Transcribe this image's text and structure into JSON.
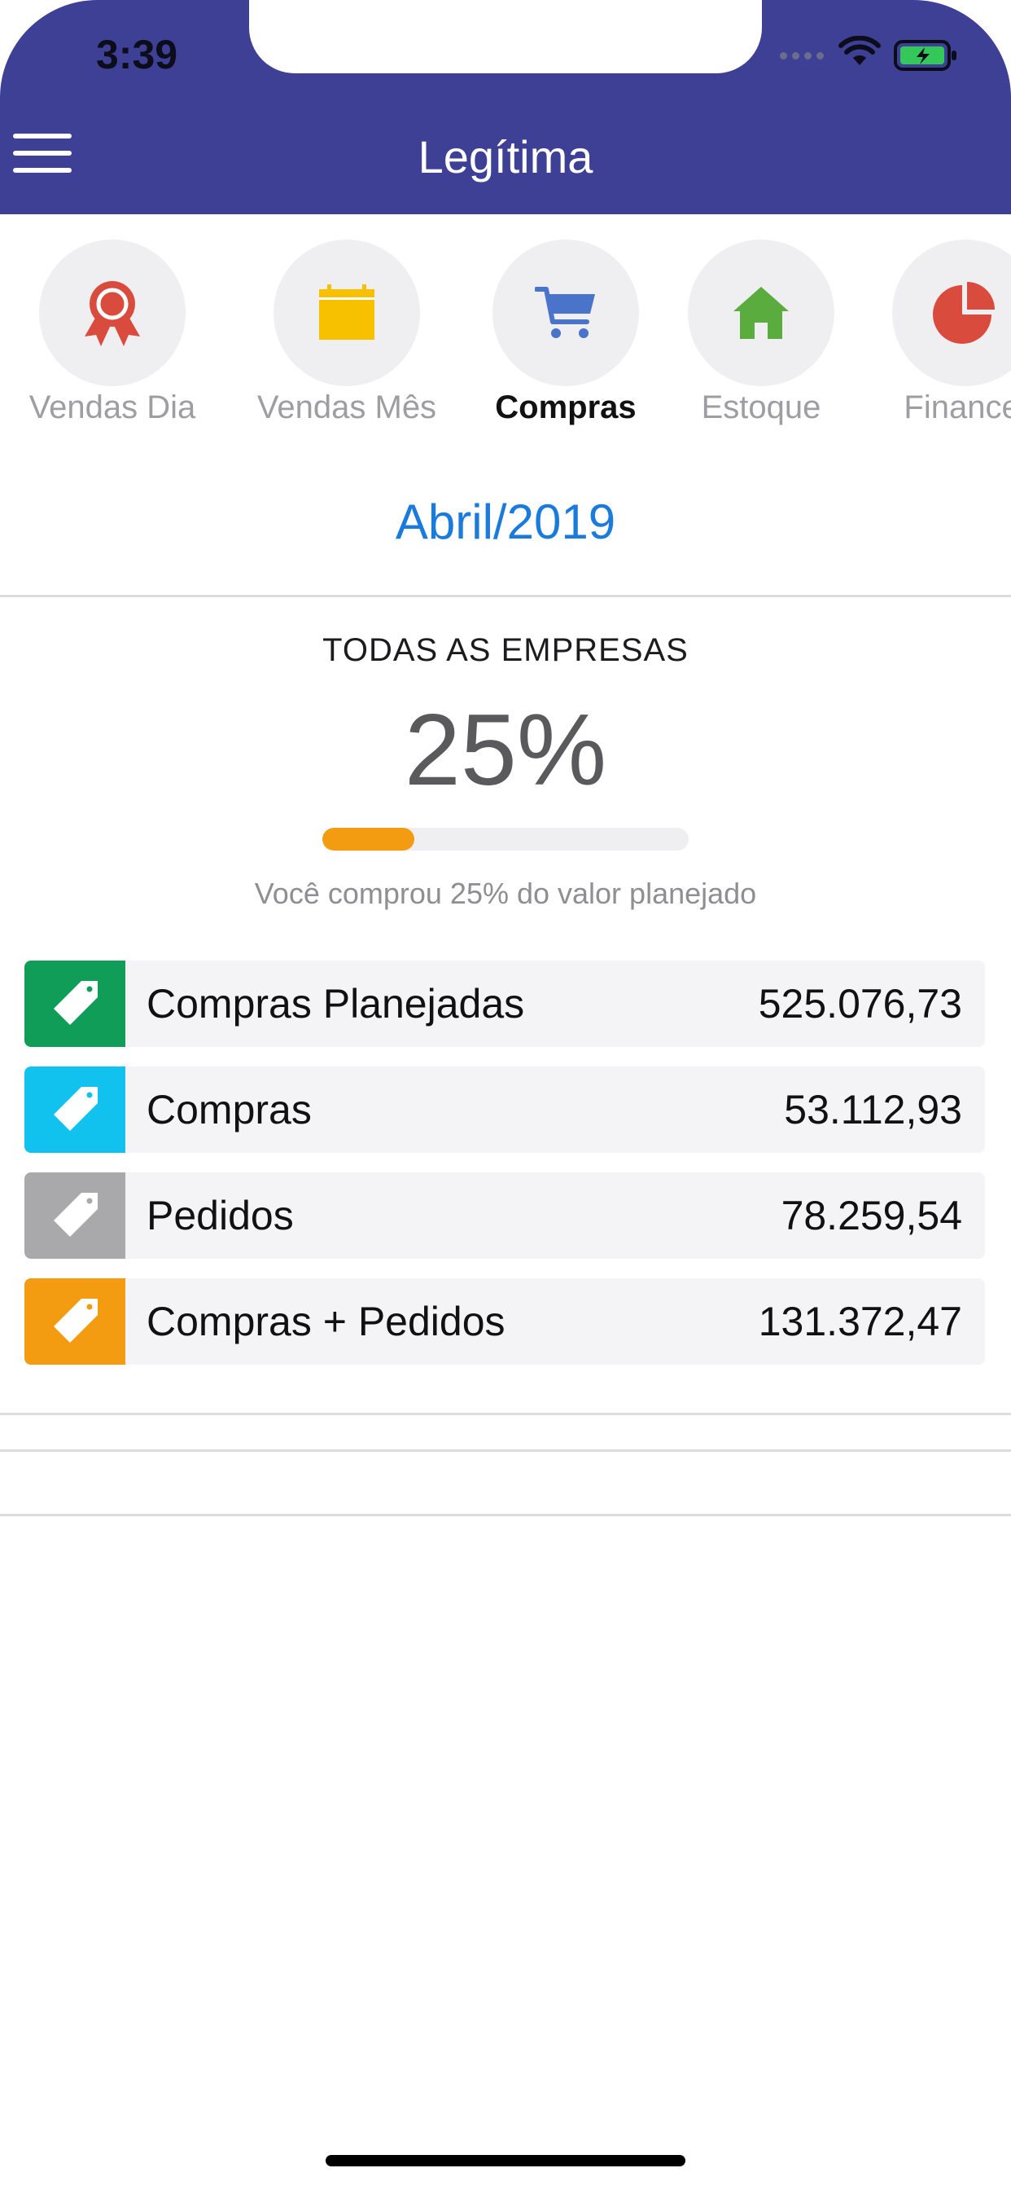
{
  "status_bar": {
    "time": "3:39"
  },
  "header": {
    "title": "Legítima"
  },
  "categories": [
    {
      "label": "Vendas Dia",
      "icon": "award-ribbon-icon",
      "color": "#d94b3d"
    },
    {
      "label": "Vendas Mês",
      "icon": "calendar-icon",
      "color": "#f7c100"
    },
    {
      "label": "Compras",
      "icon": "shopping-cart-icon",
      "color": "#4a74c9",
      "active": true
    },
    {
      "label": "Estoque",
      "icon": "house-icon",
      "color": "#5aac3e"
    },
    {
      "label": "Financei",
      "icon": "pie-chart-icon",
      "color": "#d94b3d"
    }
  ],
  "period": {
    "month": "Abril/2019"
  },
  "summary": {
    "company": "TODAS AS EMPRESAS",
    "percent_text": "25%",
    "progress_fraction": 0.25,
    "caption": "Você comprou 25% do valor planejado"
  },
  "rows": [
    {
      "label": "Compras Planejadas",
      "value": "525.076,73",
      "color": "#0f9d58",
      "icon": "tag-icon"
    },
    {
      "label": "Compras",
      "value": "53.112,93",
      "color": "#11c2ef",
      "icon": "tag-icon"
    },
    {
      "label": "Pedidos",
      "value": "78.259,54",
      "color": "#a9a9ab",
      "icon": "tag-icon"
    },
    {
      "label": "Compras + Pedidos",
      "value": "131.372,47",
      "color": "#f39c12",
      "icon": "tag-icon"
    }
  ]
}
